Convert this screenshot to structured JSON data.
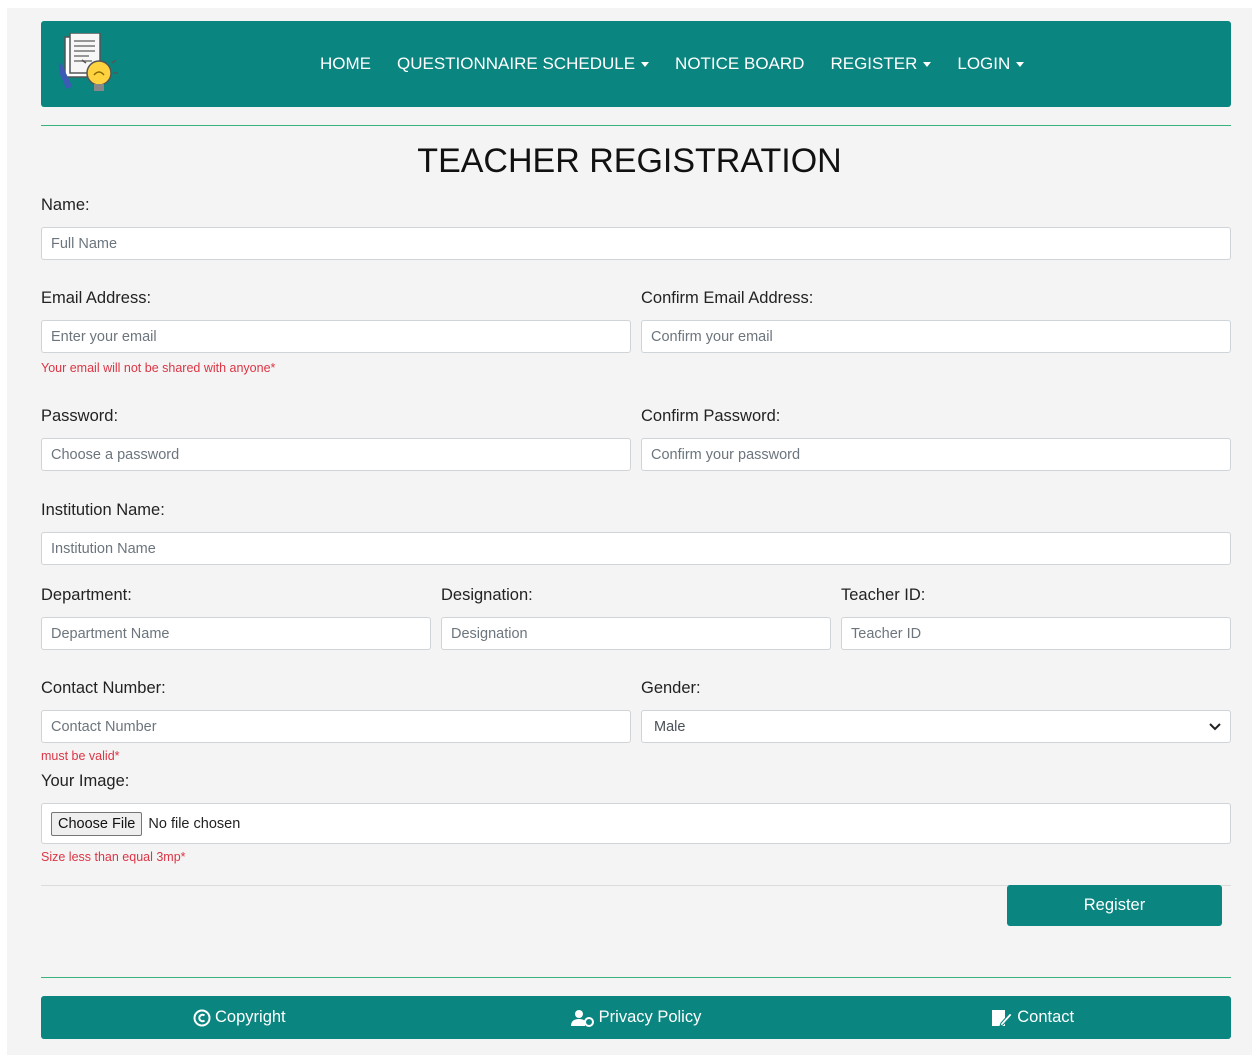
{
  "nav": {
    "items": [
      {
        "label": "HOME",
        "dropdown": false
      },
      {
        "label": "QUESTIONNAIRE SCHEDULE",
        "dropdown": true
      },
      {
        "label": "NOTICE BOARD",
        "dropdown": false
      },
      {
        "label": "REGISTER",
        "dropdown": true
      },
      {
        "label": "LOGIN",
        "dropdown": true
      }
    ],
    "logo_icon": "document-lightbulb-icon"
  },
  "form": {
    "title": "TEACHER REGISTRATION",
    "name_label": "Name:",
    "name_placeholder": "Full Name",
    "email_label": "Email Address:",
    "email_placeholder": "Enter your email",
    "email_hint": "Your email will not be shared with anyone*",
    "confirm_email_label": "Confirm Email Address:",
    "confirm_email_placeholder": "Confirm your email",
    "password_label": "Password:",
    "password_placeholder": "Choose a password",
    "confirm_password_label": "Confirm Password:",
    "confirm_password_placeholder": "Confirm your password",
    "institution_label": "Institution Name:",
    "institution_placeholder": "Institution Name",
    "department_label": "Department:",
    "department_placeholder": "Department Name",
    "designation_label": "Designation:",
    "designation_placeholder": "Designation",
    "teacher_id_label": "Teacher ID:",
    "teacher_id_placeholder": "Teacher ID",
    "contact_label": "Contact Number:",
    "contact_placeholder": "Contact Number",
    "contact_hint": "must be valid*",
    "gender_label": "Gender:",
    "gender_value": "Male",
    "image_label": "Your Image:",
    "file_button": "Choose File",
    "file_status": "No file chosen",
    "image_hint": "Size less than equal 3mp*",
    "submit_label": "Register"
  },
  "footer": {
    "copyright": "Copyright",
    "privacy": "Privacy Policy",
    "contact": "Contact"
  },
  "colors": {
    "primary": "#0b8580",
    "hint_red": "#dc3545",
    "divider_green": "#38b27a"
  }
}
